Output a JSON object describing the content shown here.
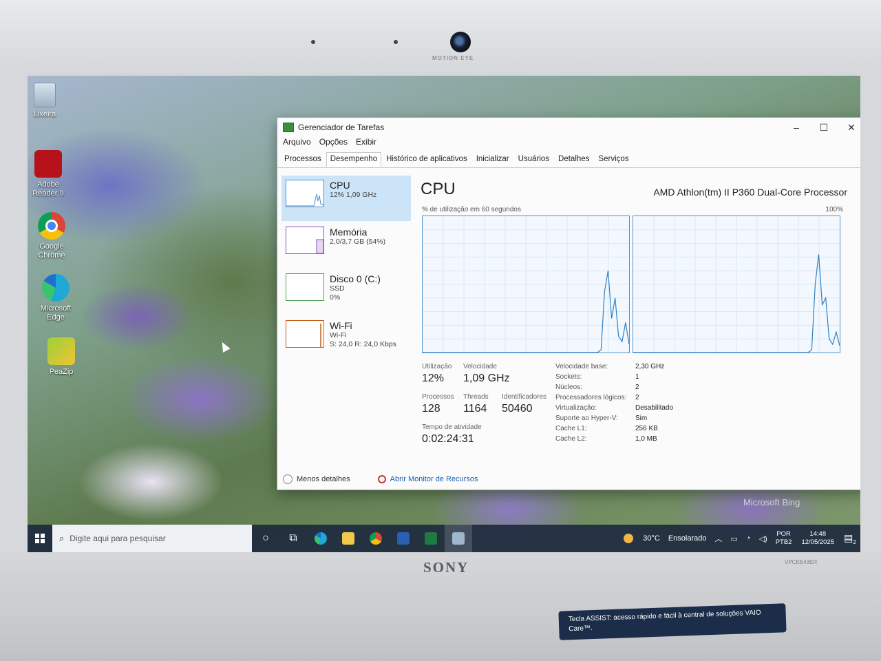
{
  "hardware": {
    "brand": "SONY",
    "camera_label": "MOTION EYE",
    "model_label": "VPCEE43ER",
    "assist_sticker": "Tecla ASSIST: acesso rápido e fácil à central de soluções VAIO Care™."
  },
  "desktop": {
    "icons": [
      {
        "label": "Lixeira",
        "icon": "recycle-bin-icon"
      },
      {
        "label": "Adobe Reader 9",
        "icon": "adobe-reader-icon"
      },
      {
        "label": "Google Chrome",
        "icon": "chrome-icon"
      },
      {
        "label": "Microsoft Edge",
        "icon": "edge-icon"
      },
      {
        "label": "PeaZip",
        "icon": "peazip-icon"
      }
    ],
    "wallpaper_credit": "Microsoft Bing"
  },
  "task_manager": {
    "title": "Gerenciador de Tarefas",
    "window_controls": {
      "minimize": "–",
      "maximize": "☐",
      "close": "✕"
    },
    "menu": [
      "Arquivo",
      "Opções",
      "Exibir"
    ],
    "tabs": [
      "Processos",
      "Desempenho",
      "Histórico de aplicativos",
      "Inicializar",
      "Usuários",
      "Detalhes",
      "Serviços"
    ],
    "active_tab": "Desempenho",
    "sidebar": [
      {
        "title": "CPU",
        "line1": "12%  1,09 GHz",
        "line2": ""
      },
      {
        "title": "Memória",
        "line1": "2,0/3,7 GB (54%)",
        "line2": ""
      },
      {
        "title": "Disco 0 (C:)",
        "line1": "SSD",
        "line2": "0%"
      },
      {
        "title": "Wi-Fi",
        "line1": "Wi-Fi",
        "line2": "S: 24,0  R: 24,0 Kbps"
      }
    ],
    "main": {
      "heading": "CPU",
      "cpu_model": "AMD Athlon(tm) II P360 Dual-Core Processor",
      "graph_caption": "% de utilização em 60 segundos",
      "graph_max": "100%",
      "graph_series": [
        [
          0,
          0,
          0,
          0,
          0,
          0,
          0,
          0,
          0,
          0,
          0,
          0,
          0,
          0,
          0,
          0,
          0,
          0,
          0,
          0,
          0,
          0,
          0,
          0,
          0,
          0,
          0,
          0,
          0,
          0,
          0,
          0,
          0,
          0,
          0,
          0,
          0,
          0,
          0,
          0,
          0,
          0,
          0,
          0,
          0,
          0,
          0,
          0,
          0,
          0,
          0,
          2,
          45,
          60,
          25,
          40,
          12,
          8,
          22,
          6
        ],
        [
          0,
          0,
          0,
          0,
          0,
          0,
          0,
          0,
          0,
          0,
          0,
          0,
          0,
          0,
          0,
          0,
          0,
          0,
          0,
          0,
          0,
          0,
          0,
          0,
          0,
          0,
          0,
          0,
          0,
          0,
          0,
          0,
          0,
          0,
          0,
          0,
          0,
          0,
          0,
          0,
          0,
          0,
          0,
          0,
          0,
          0,
          0,
          0,
          0,
          0,
          0,
          2,
          50,
          72,
          35,
          40,
          10,
          6,
          15,
          5
        ]
      ],
      "stats": {
        "utilizacao_label": "Utilização",
        "utilizacao": "12%",
        "velocidade_label": "Velocidade",
        "velocidade": "1,09 GHz",
        "processos_label": "Processos",
        "processos": "128",
        "threads_label": "Threads",
        "threads": "1164",
        "identificadores_label": "Identificadores",
        "identificadores": "50460",
        "tempo_label": "Tempo de atividade",
        "tempo": "0:02:24:31"
      },
      "details": [
        {
          "label": "Velocidade base:",
          "value": "2,30 GHz"
        },
        {
          "label": "Sockets:",
          "value": "1"
        },
        {
          "label": "Núcleos:",
          "value": "2"
        },
        {
          "label": "Processadores lógicos:",
          "value": "2"
        },
        {
          "label": "Virtualização:",
          "value": "Desabilitado"
        },
        {
          "label": "Suporte ao Hyper-V:",
          "value": "Sim"
        },
        {
          "label": "Cache L1:",
          "value": "256 KB"
        },
        {
          "label": "Cache L2:",
          "value": "1,0 MB"
        }
      ]
    },
    "footer": {
      "less_details": "Menos detalhes",
      "resource_monitor": "Abrir Monitor de Recursos"
    }
  },
  "taskbar": {
    "search_placeholder": "Digite aqui para pesquisar",
    "weather_temp": "30°C",
    "weather_desc": "Ensolarado",
    "lang1": "POR",
    "lang2": "PTB2",
    "time": "14:48",
    "date": "12/05/2025",
    "notification_count": "2"
  }
}
